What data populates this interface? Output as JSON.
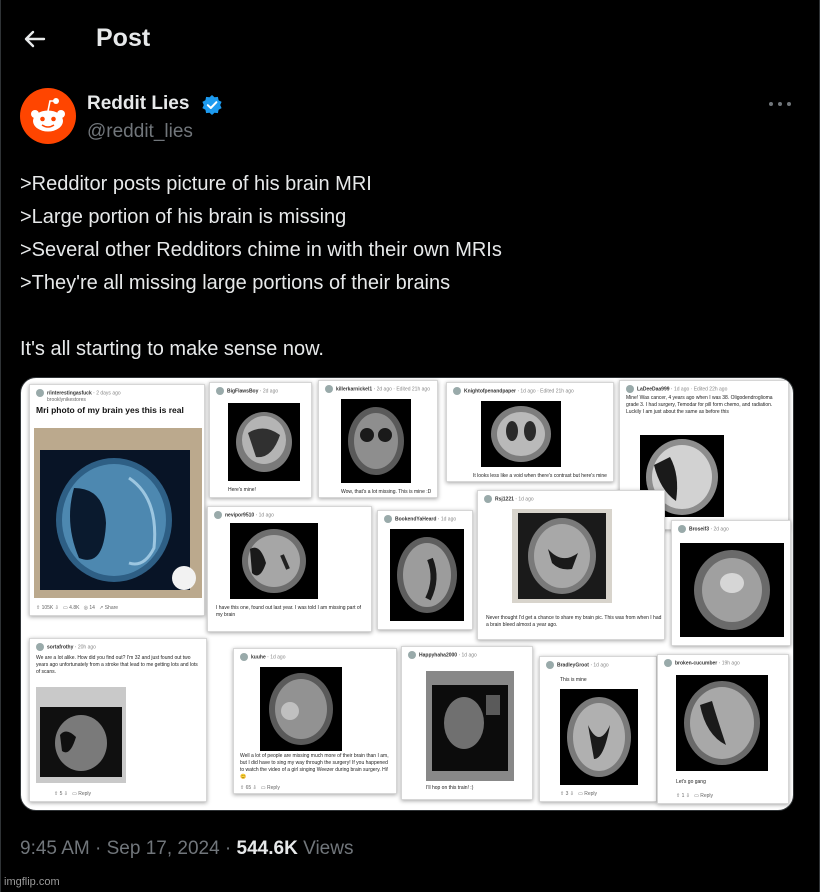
{
  "header": {
    "title": "Post"
  },
  "author": {
    "name": "Reddit Lies",
    "handle": "@reddit_lies"
  },
  "tweet": {
    "lines": [
      ">Redditor posts picture of his brain MRI",
      ">Large portion of his brain is missing",
      ">Several other Redditors chime in with their own MRIs",
      ">They're all missing large portions of their brains",
      "",
      "It's all starting to make sense now."
    ]
  },
  "cards": {
    "c1": {
      "user": "r/interestingasfuck",
      "time": "2 days ago",
      "sub": "brooklynikestores",
      "title": "Mri photo of my brain yes this is real",
      "up": "105K",
      "comments": "4.8K",
      "share_count": "14",
      "share": "Share"
    },
    "c2": {
      "user": "BigFlawsBoy",
      "time": "2d ago",
      "body": "Here's mine!"
    },
    "c3": {
      "user": "killerkarnickel1",
      "time": "2d ago · Edited 21h ago",
      "body": "Wow, that's a lot missing. This is mine :D"
    },
    "c4": {
      "user": "Knightofpenandpaper",
      "time": "1d ago · Edited 21h ago",
      "body": "It looks less like a void when there's contrast but here's mine"
    },
    "c5": {
      "user": "LaDeeDaa999",
      "time": "1d ago · Edited 22h ago",
      "body": "Mine! Was cancer, 4 years ago when I was 38. Oligodendroglioma grade 3. I had surgery, Temodar for pill form chemo, and radiation. Luckily I am just about the same as before this",
      "up": "191"
    },
    "c6": {
      "user": "nevipor9510",
      "time": "1d ago",
      "body": "I have this one, found out last year. I was told I am missing part of my brain"
    },
    "c7": {
      "user": "BookendYaHeard",
      "time": "1d ago"
    },
    "c8": {
      "user": "Rsj1221",
      "time": "1d ago",
      "body": "Never thought I'd get a chance to share my brain pic. This was from when I had a brain bleed almost a year ago."
    },
    "c9": {
      "user": "Broseif3",
      "time": "2d ago"
    },
    "c10": {
      "user": "sortafrothy",
      "time": "20h ago",
      "body": "We are a lot alike. How did you find out? I'm 32 and just found out two years ago unfortunately from a stroke that lead to me getting lots and lots of scans.",
      "up": "5",
      "reply": "Reply"
    },
    "c11": {
      "user": "kuuhe",
      "time": "1d ago",
      "body": "Well a lot of people are missing much more of their brain than I am, but I did have to sing my way through the surgery! If you happened to watch the video of a girl singing Weezer during brain surgery. Hi!😊",
      "up": "65",
      "reply": "Reply"
    },
    "c12": {
      "user": "Happyhaha2000",
      "time": "1d ago",
      "body": "I'll hop on this train! :)"
    },
    "c13": {
      "user": "BradleyGroot",
      "time": "1d ago",
      "body": "This is mine",
      "up": "3",
      "reply": "Reply"
    },
    "c14": {
      "user": "broken-cucumber",
      "time": "19h ago",
      "body": "Let's go gang",
      "up": "1",
      "reply": "Reply"
    }
  },
  "footer": {
    "time": "9:45 AM",
    "date": "Sep 17, 2024",
    "views_count": "544.6K",
    "views_label": "Views"
  },
  "watermark": "imgflip.com",
  "colors": {
    "background": "#000000",
    "text": "#e7e9ea",
    "muted": "#71767b",
    "verified": "#1d9bf0",
    "reddit_orange": "#ff4500"
  }
}
